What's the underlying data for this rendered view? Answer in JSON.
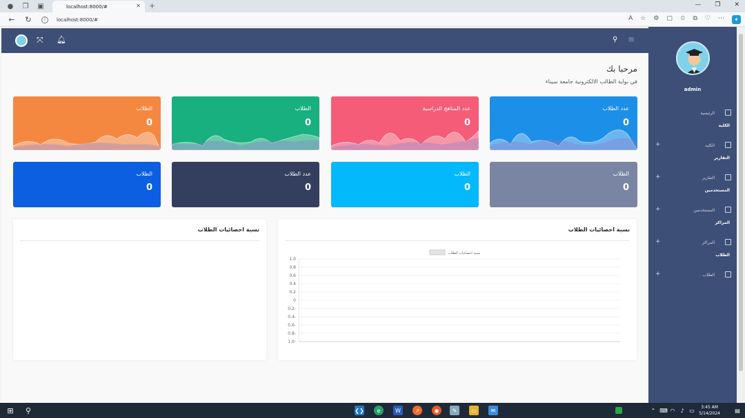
{
  "browser": {
    "tab_title": "localhost:8000/#",
    "url": "localhost:8000/#"
  },
  "page": {
    "welcome": "مرحبا بك",
    "subtitle": "في بوابة الطالب الالكترونية جامعة سيناء"
  },
  "cards": [
    {
      "label": "عدد الطلاب",
      "value": "0",
      "color": "#1c8fe8"
    },
    {
      "label": "عدد المناهج الدراسية",
      "value": "0",
      "color": "#f45c78"
    },
    {
      "label": "الطلاب",
      "value": "0",
      "color": "#17b07e"
    },
    {
      "label": "الطلاب",
      "value": "0",
      "color": "#f58840"
    },
    {
      "label": "الطلاب",
      "value": "0",
      "color": "#7a85a3"
    },
    {
      "label": "الطلاب",
      "value": "0",
      "color": "#04b9fb"
    },
    {
      "label": "عدد الطلاب",
      "value": "0",
      "color": "#343e5e"
    },
    {
      "label": "الطلاب",
      "value": "0",
      "color": "#0b5fe0"
    }
  ],
  "panels": {
    "right_title": "نسبة احصائيات الطلاب",
    "left_title": "نسبة احصائيات الطلاب"
  },
  "chart_data": {
    "type": "line",
    "title": "",
    "legend": [
      "نسبة احصائيات الطلاب"
    ],
    "x": [],
    "series": [
      {
        "name": "نسبة احصائيات الطلاب",
        "values": []
      }
    ],
    "yticks": [
      "1.0",
      "0.8",
      "0.6",
      "0.4",
      "0.2",
      "0",
      "0.2-",
      "0.4-",
      "0.6-",
      "0.8-",
      "1.0-"
    ],
    "ylim": [
      -1,
      1
    ],
    "grid": true,
    "legend_position": "top"
  },
  "sidebar": {
    "user": "admin",
    "sections": [
      {
        "type": "item",
        "label": "الرئيسية",
        "icon": "grid-icon",
        "plus": false
      },
      {
        "type": "head",
        "label": "الكلية"
      },
      {
        "type": "item",
        "label": "الكليه",
        "icon": "chart-icon",
        "plus": true
      },
      {
        "type": "head",
        "label": "التقارير"
      },
      {
        "type": "item",
        "label": "التقارير",
        "icon": "calendar-icon",
        "plus": true
      },
      {
        "type": "head",
        "label": "المستخدمين"
      },
      {
        "type": "item",
        "label": "المستخدمين",
        "icon": "id-card-icon",
        "plus": true
      },
      {
        "type": "head",
        "label": "المراكز"
      },
      {
        "type": "item",
        "label": "المراكز",
        "icon": "calendar-icon",
        "plus": true
      },
      {
        "type": "head",
        "label": "الطلاب"
      },
      {
        "type": "item",
        "label": "الطلاب",
        "icon": "calendar-icon",
        "plus": true
      }
    ]
  },
  "taskbar": {
    "time": "3:45 AM",
    "date": "5/14/2024"
  }
}
